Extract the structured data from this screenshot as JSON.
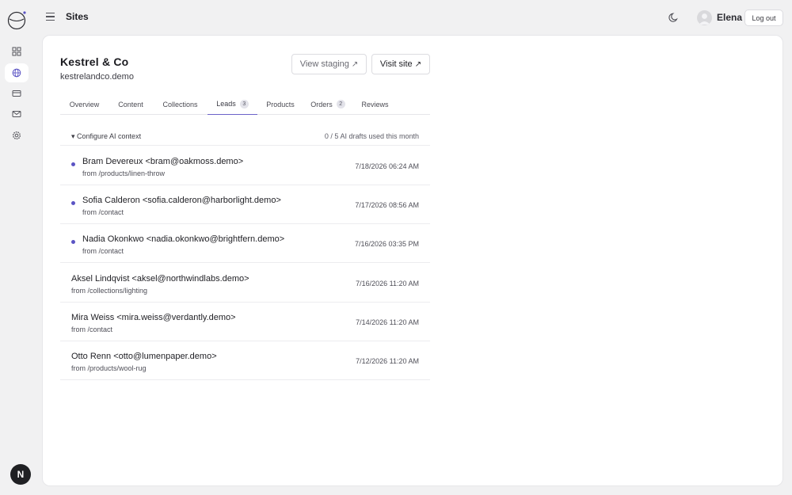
{
  "header": {
    "title": "Sites",
    "user": "Elena",
    "logout_label": "Log out"
  },
  "rail": {
    "items": [
      "dashboard-icon",
      "globe-icon",
      "card-icon",
      "mail-icon",
      "gear-icon"
    ],
    "active": "globe-icon"
  },
  "site": {
    "name": "Kestrel & Co",
    "domain": "kestrelandco.demo",
    "staging_label": "View staging",
    "visit_label": "Visit site",
    "external_glyph": "↗"
  },
  "tabs": [
    {
      "label": "Overview"
    },
    {
      "label": "Content"
    },
    {
      "label": "Collections"
    },
    {
      "label": "Leads",
      "count": "3"
    },
    {
      "label": "Products"
    },
    {
      "label": "Orders",
      "count": "2"
    },
    {
      "label": "Reviews"
    }
  ],
  "active_tab": "Leads",
  "ai": {
    "toggle_label": "▾ Configure AI context",
    "usage": "0 / 5 AI drafts used this month"
  },
  "leads": [
    {
      "who": "Bram Devereux <bram@oakmoss.demo>",
      "from": "from /products/linen-throw",
      "when": "7/18/2026 06:24 AM",
      "unread": true
    },
    {
      "who": "Sofia Calderon <sofia.calderon@harborlight.demo>",
      "from": "from /contact",
      "when": "7/17/2026 08:56 AM",
      "unread": true
    },
    {
      "who": "Nadia Okonkwo <nadia.okonkwo@brightfern.demo>",
      "from": "from /contact",
      "when": "7/16/2026 03:35 PM",
      "unread": true
    },
    {
      "who": "Aksel Lindqvist <aksel@northwindlabs.demo>",
      "from": "from /collections/lighting",
      "when": "7/16/2026 11:20 AM",
      "unread": false
    },
    {
      "who": "Mira Weiss <mira.weiss@verdantly.demo>",
      "from": "from /contact",
      "when": "7/14/2026 11:20 AM",
      "unread": false
    },
    {
      "who": "Otto Renn <otto@lumenpaper.demo>",
      "from": "from /products/wool-rug",
      "when": "7/12/2026 11:20 AM",
      "unread": false
    }
  ],
  "badge": "N",
  "colors": {
    "accent": "#5b54c4",
    "background": "#f1f1f2",
    "card": "#ffffff"
  }
}
